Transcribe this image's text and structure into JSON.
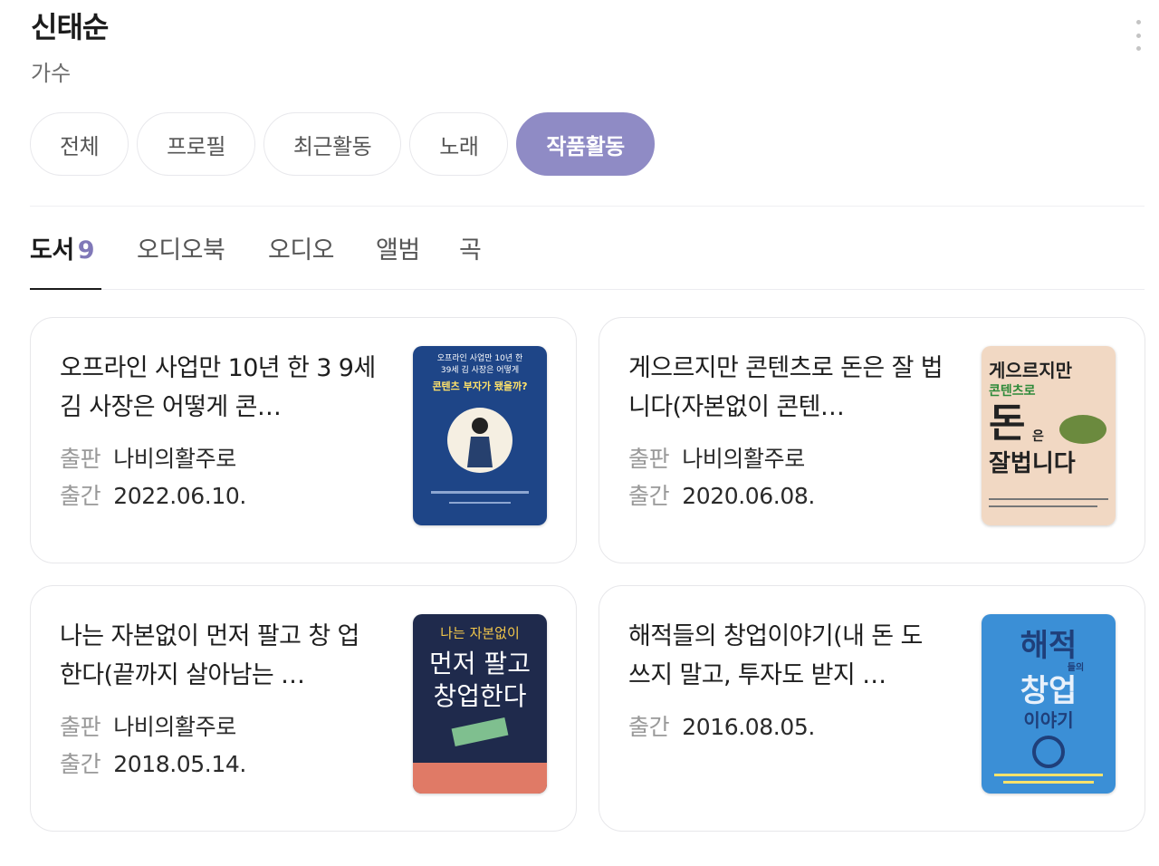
{
  "header": {
    "title": "신태순",
    "subtitle": "가수"
  },
  "chips": [
    {
      "label": "전체",
      "active": false
    },
    {
      "label": "프로필",
      "active": false
    },
    {
      "label": "최근활동",
      "active": false
    },
    {
      "label": "노래",
      "active": false
    },
    {
      "label": "작품활동",
      "active": true
    }
  ],
  "tabs": [
    {
      "label": "도서",
      "count": "9",
      "active": true
    },
    {
      "label": "오디오북"
    },
    {
      "label": "오디오"
    },
    {
      "label": "앨범"
    },
    {
      "label": "곡"
    }
  ],
  "meta_labels": {
    "publisher": "출판",
    "date": "출간"
  },
  "books": [
    {
      "title": "오프라인 사업만 10년 한 39세 김 사장은 어떻게 콘텐츠 부자가 됐을까?",
      "title_display": "오프라인 사업만 10년 한 3 9세 김 사장은 어떻게 콘…",
      "publisher": "나비의활주로",
      "date": "2022.06.10.",
      "cover": {
        "bg": "#1e4587",
        "lines": [
          "오프라인 사업만 10년 한",
          "39세 김 사장은 어떻게",
          "콘텐츠 부자가 됐을까?"
        ]
      }
    },
    {
      "title": "게으르지만 콘텐츠로 돈은 잘 법니다(자본없이 콘텐츠로…",
      "title_display": "게으르지만 콘텐츠로 돈은 잘 법니다(자본없이 콘텐…",
      "publisher": "나비의활주로",
      "date": "2020.06.08.",
      "cover": {
        "bg": "#f1d8c3",
        "lines": [
          "게으르지만",
          "콘텐츠로",
          "돈",
          "은",
          "잘법니다"
        ]
      }
    },
    {
      "title": "나는 자본없이 먼저 팔고 창업한다(끝까지 살아남는 …",
      "title_display": "나는 자본없이 먼저 팔고 창 업한다(끝까지 살아남는 …",
      "publisher": "나비의활주로",
      "date": "2018.05.14.",
      "cover": {
        "bg": "#1f2a4c",
        "lines": [
          "나는 자본없이",
          "먼저 팔고",
          "창업한다"
        ]
      }
    },
    {
      "title": "해적들의 창업이야기(내 돈도 쓰지 말고, 투자도 받지 …",
      "title_display": "해적들의 창업이야기(내 돈 도 쓰지 말고, 투자도 받지 …",
      "date": "2016.08.05.",
      "cover": {
        "bg": "#3b8fd6",
        "lines": [
          "해적",
          "들의",
          "창업",
          "이야기"
        ]
      }
    }
  ],
  "colors": {
    "accent": "#8f8bc5",
    "count": "#8078b8"
  },
  "icons": {
    "more": "more-vertical-icon"
  }
}
